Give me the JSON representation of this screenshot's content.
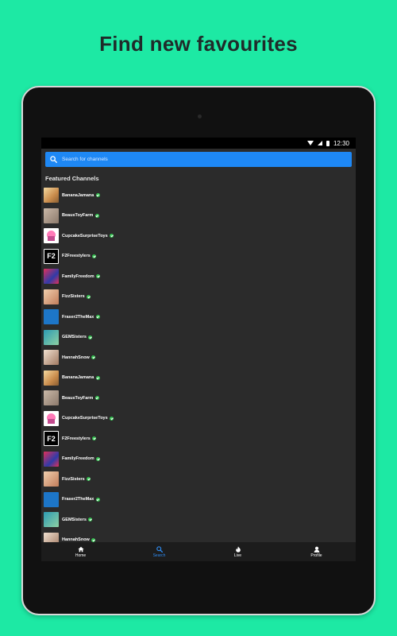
{
  "promo": {
    "title": "Find new favourites"
  },
  "status_bar": {
    "time": "12:30"
  },
  "search": {
    "placeholder": "Search for channels"
  },
  "section": {
    "title": "Featured Channels"
  },
  "channels": [
    {
      "name": "BananaJamana",
      "thumb": "banana"
    },
    {
      "name": "BeausToyFarm",
      "thumb": "beaus"
    },
    {
      "name": "CupcakeSurpriseToys",
      "thumb": "cupcake"
    },
    {
      "name": "F2Freestylers",
      "thumb": "f2"
    },
    {
      "name": "FamilyFreedom",
      "thumb": "family"
    },
    {
      "name": "FizzSisters",
      "thumb": "fizz"
    },
    {
      "name": "Fraser2TheMax",
      "thumb": "fraser"
    },
    {
      "name": "GEMSisters",
      "thumb": "gem"
    },
    {
      "name": "HannahSnow",
      "thumb": "hannah"
    },
    {
      "name": "BananaJamana",
      "thumb": "banana"
    },
    {
      "name": "BeausToyFarm",
      "thumb": "beaus"
    },
    {
      "name": "CupcakeSurpriseToys",
      "thumb": "cupcake"
    },
    {
      "name": "F2Freestylers",
      "thumb": "f2"
    },
    {
      "name": "FamilyFreedom",
      "thumb": "family"
    },
    {
      "name": "FizzSisters",
      "thumb": "fizz"
    },
    {
      "name": "Fraser2TheMax",
      "thumb": "fraser"
    },
    {
      "name": "GEMSisters",
      "thumb": "gem"
    },
    {
      "name": "HannahSnow",
      "thumb": "hannah"
    }
  ],
  "nav": {
    "home": "Home",
    "search": "Search",
    "live": "Live",
    "profile": "Profile"
  },
  "colors": {
    "background": "#1de9a4",
    "accent": "#1e88f5",
    "verified": "#33c24f"
  }
}
